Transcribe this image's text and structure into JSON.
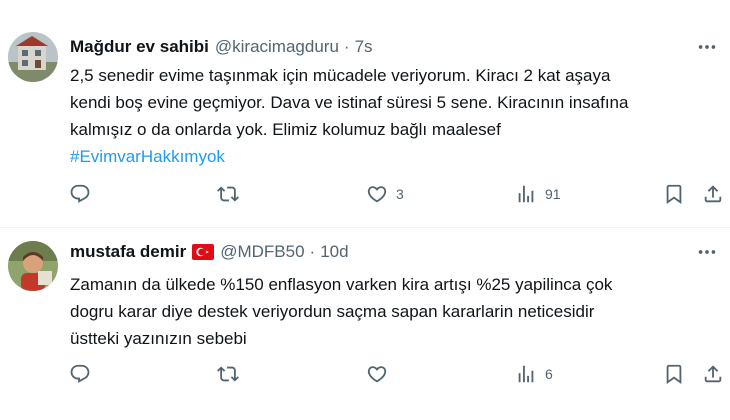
{
  "tweets": [
    {
      "name": "Mağdur ev sahibi",
      "handle": "@kiracimagduru",
      "separator": "·",
      "time": "7s",
      "lines": [
        "2,5 senedir evime taşınmak için mücadele veriyorum. Kiracı 2 kat aşaya",
        "kendi boş evine geçmiyor. Dava ve istinaf süresi 5 sene. Kiracının insafına",
        "kalmışız o da onlarda yok. Elimiz kolumuz bağlı maalesef"
      ],
      "hashtag": "#EvimvarHakkımyok",
      "likes": "3",
      "views": "91"
    },
    {
      "name": "mustafa demir",
      "handle": "@MDFB50",
      "separator": "·",
      "time": "10d",
      "lines": [
        "Zamanın da ülkede %150 enflasyon varken kira artışı %25 yapilinca çok",
        "dogru karar diye destek veriyordun saçma sapan kararlarin neticesidir",
        "üstteki yazınızın sebebi"
      ],
      "views": "6"
    }
  ],
  "icons": [
    "reply-icon",
    "retweet-icon",
    "like-icon",
    "views-icon",
    "bookmark-icon",
    "share-icon",
    "more-icon",
    "turkey-flag-icon"
  ],
  "colors": {
    "text": "#0f1419",
    "secondary": "#536471",
    "link": "#1d9bf0",
    "flag": "#e30a17"
  }
}
